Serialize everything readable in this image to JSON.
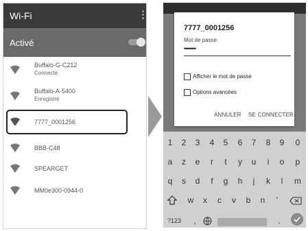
{
  "left_screen": {
    "title": "Wi-Fi",
    "menu_icon": "more-vert-icon",
    "status_label": "Activé",
    "toggle_on": true,
    "networks": [
      {
        "ssid": "Buffalo-G-C212",
        "status": "Connecté"
      },
      {
        "ssid": "Buffalo-A-5400",
        "status": "Enregistré"
      },
      {
        "ssid": "7777_0001256",
        "status": ""
      },
      {
        "ssid": "BBB-C48",
        "status": ""
      },
      {
        "ssid": "SPEARGET",
        "status": ""
      },
      {
        "ssid": "MM0e300-0944-0",
        "status": ""
      }
    ]
  },
  "right_screen": {
    "dialog": {
      "title": "7777_0001256",
      "password_label": "Mot de passe",
      "password_value": "••••••••",
      "show_password_label": "Afficher le mot de passe",
      "advanced_options_label": "Options avancées",
      "cancel_label": "ANNULER",
      "connect_label": "SE CONNECTER"
    },
    "keyboard": {
      "row1": [
        "1",
        "2",
        "3",
        "4",
        "5",
        "6",
        "7",
        "8",
        "9",
        "0"
      ],
      "row2": [
        "a",
        "z",
        "e",
        "r",
        "t",
        "y",
        "u",
        "i",
        "o",
        "p"
      ],
      "row3": [
        "q",
        "s",
        "d",
        "f",
        "g",
        "h",
        "j",
        "k",
        "l",
        "m"
      ],
      "row4": [
        "w",
        "x",
        "c",
        "v",
        "b",
        "n",
        "'"
      ],
      "bottom": {
        "symbols": "?123",
        "comma": ",",
        "period": "."
      }
    }
  },
  "colors": {
    "header": "#3a3a3a",
    "status_bar": "#6a6a6a",
    "keyboard_bg": "#d0d0d0"
  }
}
